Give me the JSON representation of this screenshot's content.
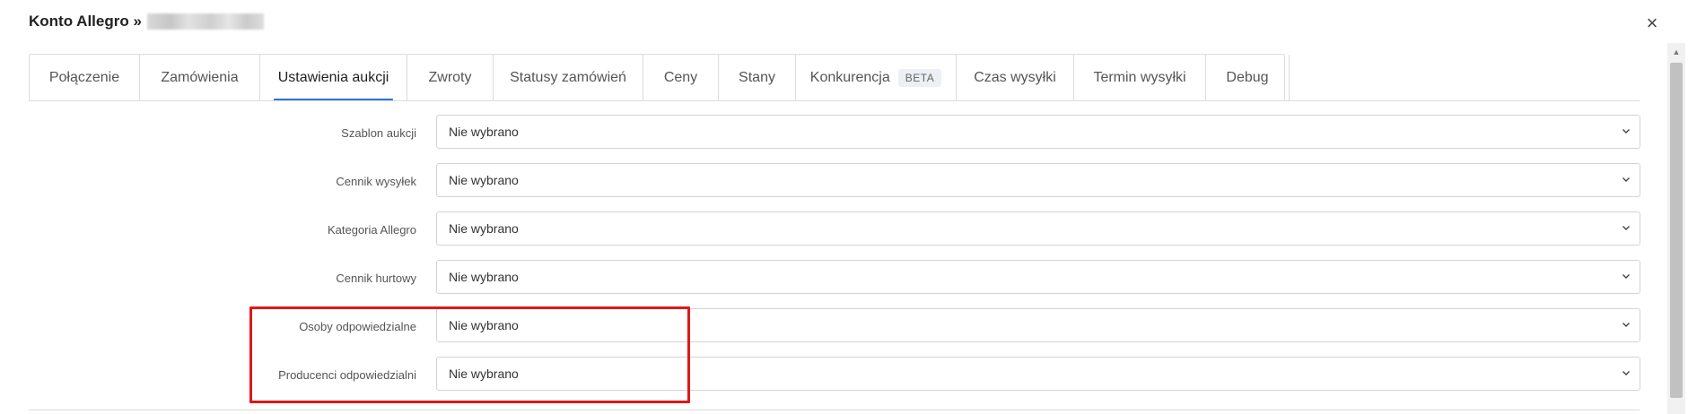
{
  "window": {
    "title": "Konto Allegro »",
    "close_symbol": "×"
  },
  "tabs": [
    {
      "label": "Połączenie"
    },
    {
      "label": "Zamówienia"
    },
    {
      "label": "Ustawienia aukcji",
      "active": true
    },
    {
      "label": "Zwroty"
    },
    {
      "label": "Statusy zamówień"
    },
    {
      "label": "Ceny"
    },
    {
      "label": "Stany"
    },
    {
      "label": "Konkurencja",
      "badge": "BETA"
    },
    {
      "label": "Czas wysyłki"
    },
    {
      "label": "Termin wysyłki"
    },
    {
      "label": "Debug"
    }
  ],
  "form": {
    "fields": [
      {
        "label": "Szablon aukcji",
        "value": "Nie wybrano"
      },
      {
        "label": "Cennik wysyłek",
        "value": "Nie wybrano"
      },
      {
        "label": "Kategoria Allegro",
        "value": "Nie wybrano"
      },
      {
        "label": "Cennik hurtowy",
        "value": "Nie wybrano"
      },
      {
        "label": "Osoby odpowiedzialne",
        "value": "Nie wybrano"
      },
      {
        "label": "Producenci odpowiedzialni",
        "value": "Nie wybrano"
      }
    ]
  },
  "colors": {
    "accent": "#2f73d8",
    "highlight": "#e01818"
  }
}
